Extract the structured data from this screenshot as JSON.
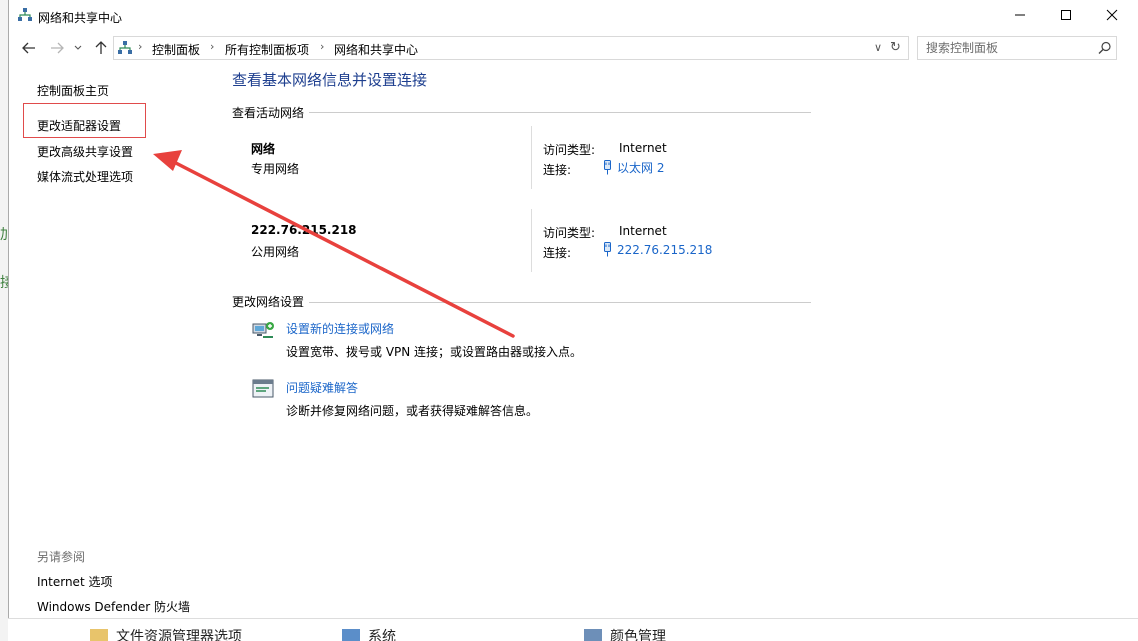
{
  "window": {
    "title": "网络和共享中心"
  },
  "background": {
    "left_marks": [
      "加",
      "接"
    ],
    "bottom_items": [
      "文件资源管理器选项",
      "系统",
      "颜色管理"
    ]
  },
  "address": {
    "breadcrumbs": [
      "控制面板",
      "所有控制面板项",
      "网络和共享中心"
    ],
    "search_placeholder": "搜索控制面板"
  },
  "sidebar": {
    "links": [
      "控制面板主页",
      "更改适配器设置",
      "更改高级共享设置",
      "媒体流式处理选项"
    ],
    "see_also_heading": "另请参阅",
    "see_also": [
      "Internet 选项",
      "Windows Defender 防火墙"
    ]
  },
  "main": {
    "title": "查看基本网络信息并设置连接",
    "active_networks_heading": "查看活动网络",
    "networks": [
      {
        "name": "网络",
        "type": "专用网络",
        "access_label": "访问类型:",
        "access_value": "Internet",
        "connection_label": "连接:",
        "connection_value": "以太网 2"
      },
      {
        "name": "222.76.215.218",
        "type": "公用网络",
        "access_label": "访问类型:",
        "access_value": "Internet",
        "connection_label": "连接:",
        "connection_value": "222.76.215.218"
      }
    ],
    "change_settings_heading": "更改网络设置",
    "tasks": [
      {
        "link": "设置新的连接或网络",
        "description": "设置宽带、拨号或 VPN 连接；或设置路由器或接入点。",
        "icon": "network-setup-icon"
      },
      {
        "link": "问题疑难解答",
        "description": "诊断并修复网络问题，或者获得疑难解答信息。",
        "icon": "troubleshoot-icon"
      }
    ]
  },
  "colors": {
    "link_blue": "#1b66c9",
    "title_blue": "#1e3f8f",
    "annotation_red": "#e8413d"
  }
}
